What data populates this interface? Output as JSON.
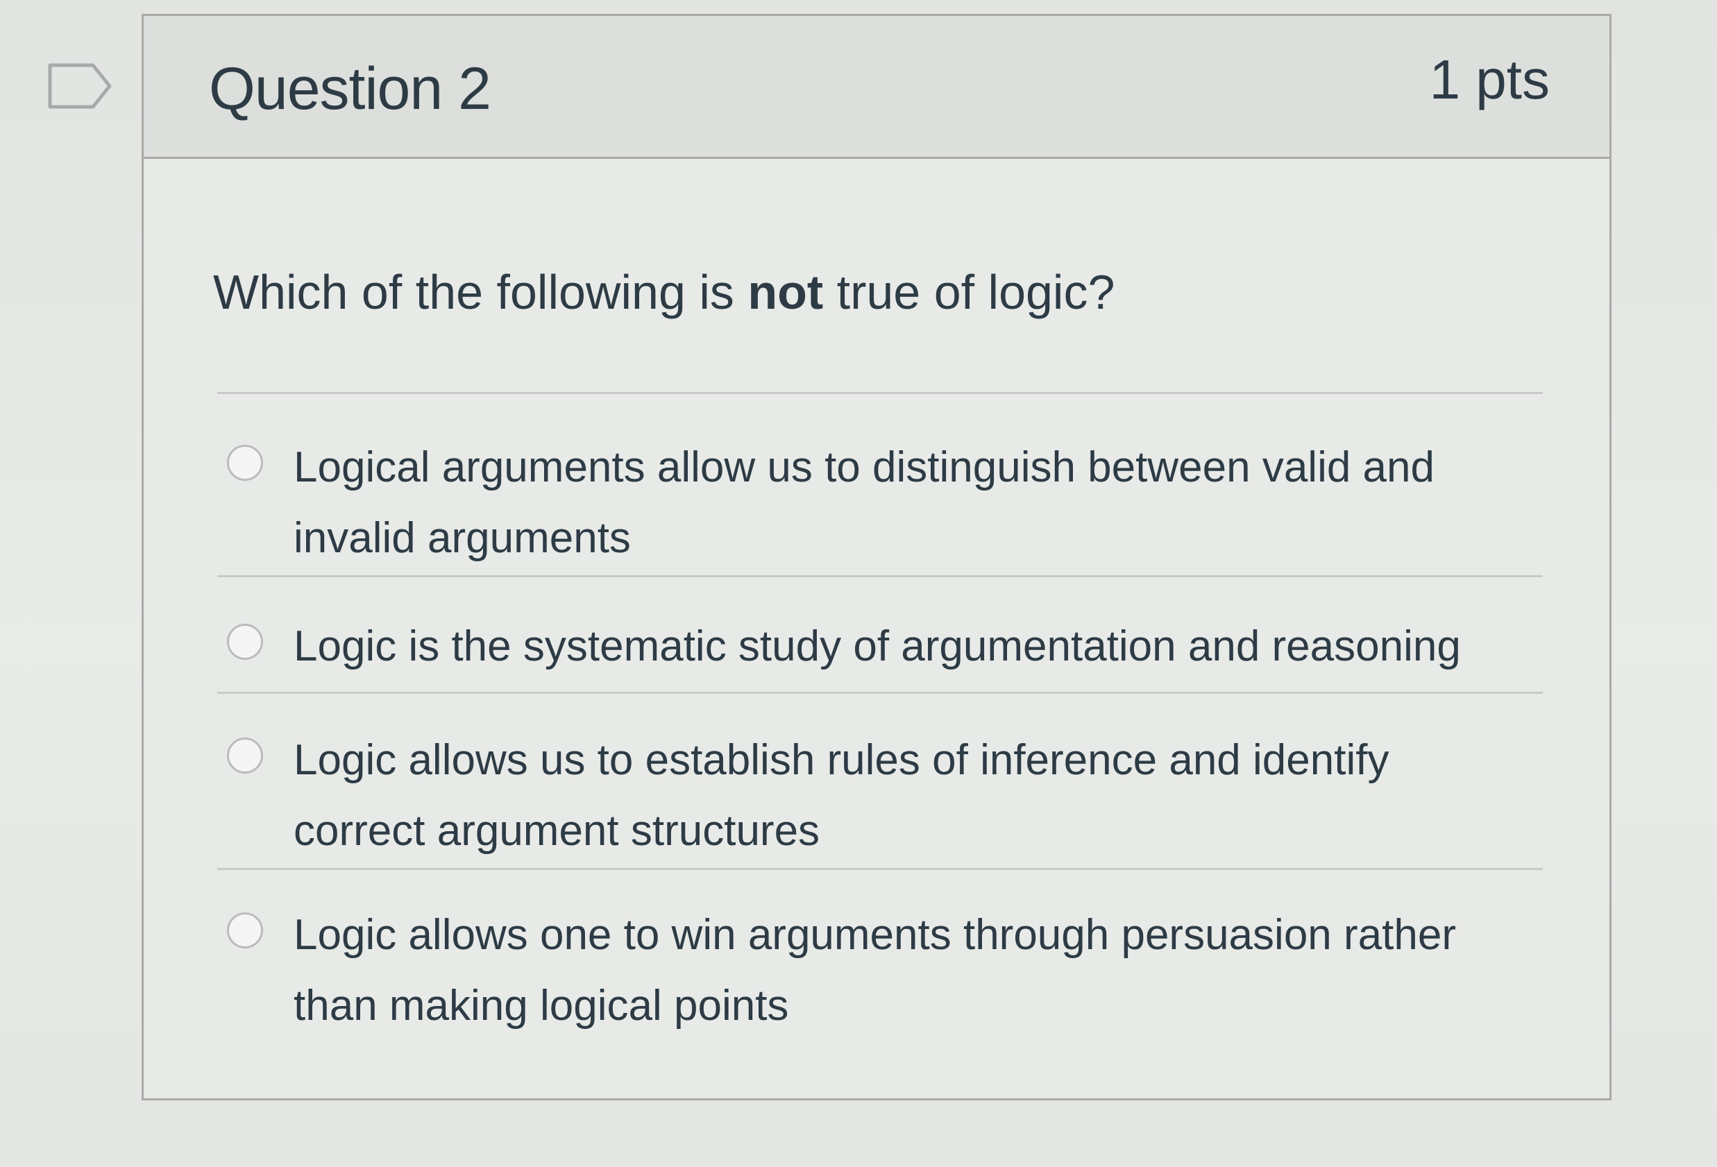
{
  "question": {
    "title": "Question 2",
    "points": "1 pts",
    "text_before": "Which of the following is ",
    "text_bold": "not",
    "text_after": " true of logic?"
  },
  "answers": [
    {
      "label": "Logical arguments allow us to distinguish between valid and invalid arguments",
      "selected": false
    },
    {
      "label": "Logic is the systematic study of argumentation and reasoning",
      "selected": false
    },
    {
      "label": "Logic allows us to establish rules of inference and identify correct argument structures",
      "selected": false
    },
    {
      "label": "Logic allows one to win arguments through persuasion rather than making logical points",
      "selected": false
    }
  ],
  "icons": {
    "flag": "flag-question-icon"
  },
  "colors": {
    "text": "#2d3b45",
    "border": "#a9aaa8",
    "header_bg": "#dddfdd"
  }
}
